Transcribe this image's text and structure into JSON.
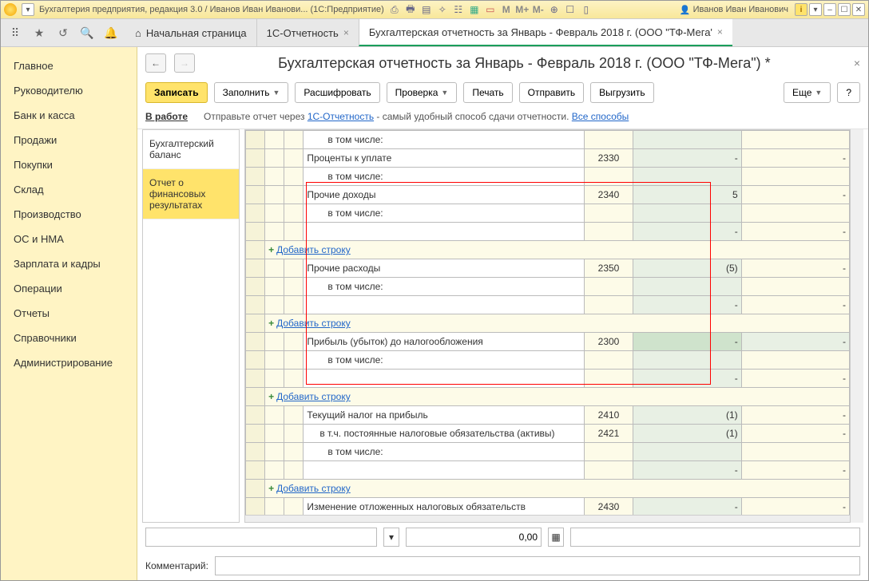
{
  "title": "Бухгалтерия предприятия, редакция 3.0 / Иванов Иван Иванови...  (1С:Предприятие)",
  "user": "Иванов Иван Иванович",
  "tabs": {
    "home": "Начальная страница",
    "t1": "1С-Отчетность",
    "t2": "Бухгалтерская отчетность за Январь - Февраль 2018 г. (ООО \"ТФ-Мега\") *"
  },
  "nav": [
    "Главное",
    "Руководителю",
    "Банк и касса",
    "Продажи",
    "Покупки",
    "Склад",
    "Производство",
    "ОС и НМА",
    "Зарплата и кадры",
    "Операции",
    "Отчеты",
    "Справочники",
    "Администрирование"
  ],
  "page": {
    "title": "Бухгалтерская отчетность за Январь - Февраль 2018 г. (ООО \"ТФ-Мега\") *",
    "buttons": {
      "save": "Записать",
      "fill": "Заполнить",
      "decode": "Расшифровать",
      "check": "Проверка",
      "print": "Печать",
      "send": "Отправить",
      "export": "Выгрузить",
      "more": "Еще",
      "help": "?"
    },
    "status_label": "В работе",
    "hint_pre": "Отправьте отчет через ",
    "hint_link": "1С-Отчетность",
    "hint_post": " - самый удобный способ сдачи отчетности. ",
    "hint_all": "Все способы"
  },
  "sections": {
    "s1": "Бухгалтерский баланс",
    "s2": "Отчет о финансовых результатах"
  },
  "rows": {
    "sub0": "в том числе:",
    "r1": "Проценты к уплате",
    "c1": "2330",
    "r2": "Прочие доходы",
    "c2": "2340",
    "v2": "5",
    "r3": "Прочие расходы",
    "c3": "2350",
    "v3": "(5)",
    "r4": "Прибыль (убыток) до налогообложения",
    "c4": "2300",
    "r5": "Текущий налог на прибыль",
    "c5": "2410",
    "v5": "(1)",
    "r6": "в т.ч. постоянные налоговые обязательства (активы)",
    "c6": "2421",
    "v6": "(1)",
    "r7": "Изменение отложенных налоговых обязательств",
    "c7": "2430",
    "add": "Добавить строку",
    "dash": "-"
  },
  "footer": {
    "numeric": "0,00",
    "comment_label": "Комментарий:"
  }
}
